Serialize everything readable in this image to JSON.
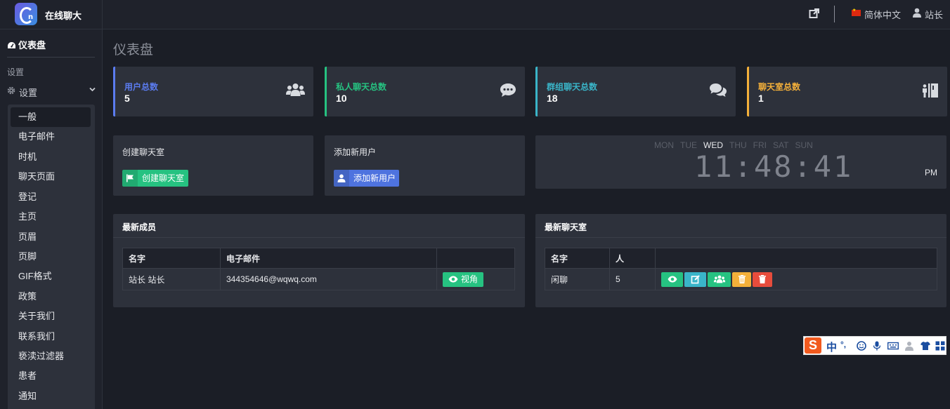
{
  "header": {
    "brand": "在线聊大",
    "language": "简体中文",
    "user": "站长"
  },
  "sidebar": {
    "dashboard": "仪表盘",
    "section": "设置",
    "settings": "设置",
    "items": [
      "一般",
      "电子邮件",
      "时机",
      "聊天页面",
      "登记",
      "主页",
      "页眉",
      "页脚",
      "GIF格式",
      "政策",
      "关于我们",
      "联系我们",
      "亵渎过滤器",
      "患者",
      "通知"
    ]
  },
  "page_title": "仪表盘",
  "stats": [
    {
      "label": "用户总数",
      "value": "5",
      "color": "#5b7cf0",
      "icon": "users-icon"
    },
    {
      "label": "私人聊天总数",
      "value": "10",
      "color": "#26c281",
      "icon": "comment-dots-icon"
    },
    {
      "label": "群组聊天总数",
      "value": "18",
      "color": "#3ab5c9",
      "icon": "comments-icon"
    },
    {
      "label": "聊天室总数",
      "value": "1",
      "color": "#f4b03a",
      "icon": "person-booth-icon"
    }
  ],
  "create_room": {
    "title": "创建聊天室",
    "button": "创建聊天室"
  },
  "add_user": {
    "title": "添加新用户",
    "button": "添加新用户"
  },
  "clock": {
    "days": [
      "MON",
      "TUE",
      "WED",
      "THU",
      "FRI",
      "SAT",
      "SUN"
    ],
    "current_day": "WED",
    "time": "11:48:41",
    "ampm": "PM"
  },
  "latest_members": {
    "title": "最新成员",
    "headers": [
      "名字",
      "电子邮件",
      ""
    ],
    "rows": [
      {
        "name": "站长 站长",
        "email": "344354646@wqwq.com",
        "action": "视角"
      }
    ]
  },
  "latest_rooms": {
    "title": "最新聊天室",
    "headers": [
      "名字",
      "人",
      ""
    ],
    "rows": [
      {
        "name": "闲聊",
        "people": "5"
      }
    ]
  },
  "ime": {
    "logo": "S",
    "mode": "中",
    "punct": "°,"
  },
  "colors": {
    "green": "#26c281",
    "blue": "#5b7cf0",
    "cyan": "#3ab5c9",
    "yellow": "#f4b03a",
    "red": "#e74c3c"
  }
}
